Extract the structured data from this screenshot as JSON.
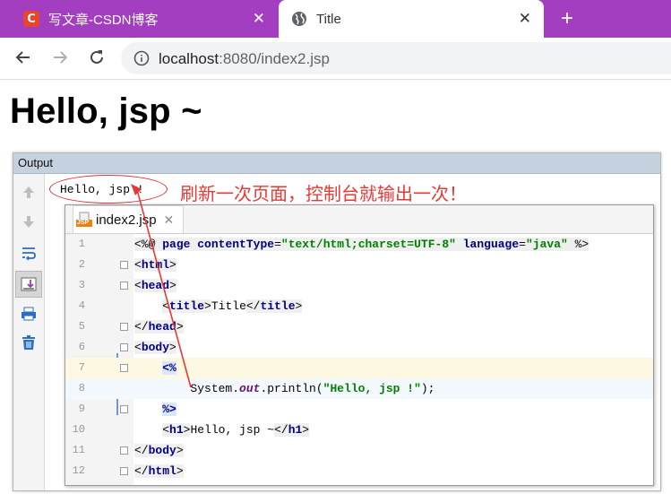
{
  "browser": {
    "tabs": [
      {
        "title": "写文章-CSDN博客",
        "logo": "C",
        "icon": "csdn-logo-icon",
        "active": false
      },
      {
        "title": "Title",
        "icon": "globe-icon",
        "active": true
      }
    ],
    "close_glyph": "✕",
    "new_tab_glyph": "+",
    "url_host": "localhost",
    "url_rest": ":8080/index2.jsp",
    "accent": "#a33ec0"
  },
  "page": {
    "heading": "Hello, jsp ~"
  },
  "output_panel": {
    "title": "Output",
    "console_text": "Hello, jsp !",
    "annotation": "刷新一次页面，控制台就输出一次！",
    "annotation_color": "#e53935"
  },
  "editor": {
    "tab_name": "index2.jsp",
    "tab_close": "✕",
    "jsp_badge": "JSP",
    "line_numbers": [
      "1",
      "2",
      "3",
      "4",
      "5",
      "6",
      "7",
      "8",
      "9",
      "10",
      "11",
      "12"
    ]
  }
}
